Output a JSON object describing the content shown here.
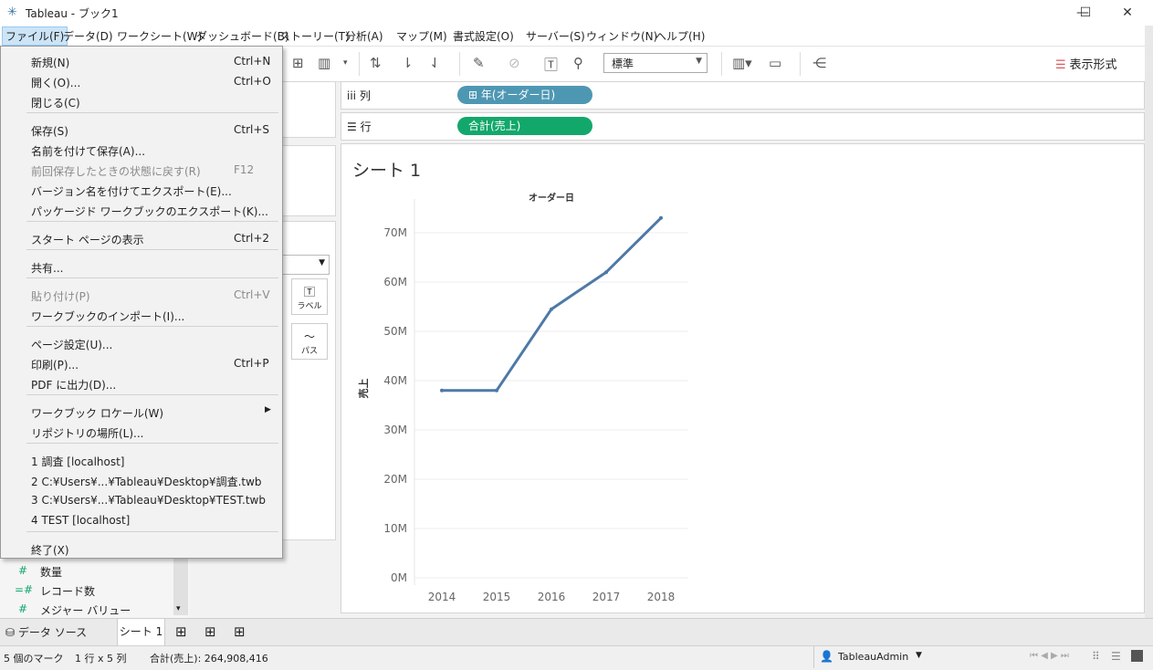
{
  "window": {
    "title": "Tableau - ブック1"
  },
  "menubar": [
    "ファイル(F)",
    "データ(D)",
    "ワークシート(W)",
    "ダッシュボード(B)",
    "ストーリー(T)",
    "分析(A)",
    "マップ(M)",
    "書式設定(O)",
    "サーバー(S)",
    "ウィンドウ(N)",
    "ヘルプ(H)"
  ],
  "toolbar": {
    "zoom_value": "標準",
    "show_me_label": "表示形式"
  },
  "shelves": {
    "columns_label": "列",
    "columns_pill": "⊞ 年(オーダー日)",
    "rows_label": "行",
    "rows_pill": "合計(売上)"
  },
  "colors": {
    "columns_pill": "#4e97b3",
    "rows_pill": "#13a86b",
    "line": "#4e79a7"
  },
  "sheet": {
    "title": "シート 1"
  },
  "marks": {
    "label_button": "ラベル",
    "path_button": "パス"
  },
  "data_pane": {
    "measures": [
      "数量",
      "レコード数",
      "メジャー バリュー"
    ]
  },
  "file_menu": {
    "items": [
      {
        "label": "新規(N)",
        "shortcut": "Ctrl+N"
      },
      {
        "label": "開く(O)...",
        "shortcut": "Ctrl+O"
      },
      {
        "label": "閉じる(C)",
        "shortcut": ""
      },
      {
        "label": "保存(S)",
        "shortcut": "Ctrl+S"
      },
      {
        "label": "名前を付けて保存(A)...",
        "shortcut": ""
      },
      {
        "label": "前回保存したときの状態に戻す(R)",
        "shortcut": "F12"
      },
      {
        "label": "バージョン名を付けてエクスポート(E)...",
        "shortcut": ""
      },
      {
        "label": "パッケージド ワークブックのエクスポート(K)...",
        "shortcut": ""
      },
      {
        "label": "スタート ページの表示",
        "shortcut": "Ctrl+2"
      },
      {
        "label": "共有...",
        "shortcut": ""
      },
      {
        "label": "貼り付け(P)",
        "shortcut": "Ctrl+V"
      },
      {
        "label": "ワークブックのインポート(I)...",
        "shortcut": ""
      },
      {
        "label": "ページ設定(U)...",
        "shortcut": ""
      },
      {
        "label": "印刷(P)...",
        "shortcut": "Ctrl+P"
      },
      {
        "label": "PDF に出力(D)...",
        "shortcut": ""
      },
      {
        "label": "ワークブック ロケール(W)",
        "shortcut": ""
      },
      {
        "label": "リポジトリの場所(L)...",
        "shortcut": ""
      },
      {
        "label": "1 調査 [localhost]",
        "shortcut": ""
      },
      {
        "label": "2 C:¥Users¥...¥Tableau¥Desktop¥調査.twb",
        "shortcut": ""
      },
      {
        "label": "3 C:¥Users¥...¥Tableau¥Desktop¥TEST.twb",
        "shortcut": ""
      },
      {
        "label": "4 TEST [localhost]",
        "shortcut": ""
      },
      {
        "label": "終了(X)",
        "shortcut": ""
      }
    ]
  },
  "tabs": {
    "data_source": "データ ソース",
    "sheet1": "シート 1"
  },
  "status": {
    "marks": "5 個のマーク",
    "dims": "1 行 x 5 列",
    "sum": "合計(売上): 264,908,416",
    "user": "TableauAdmin"
  },
  "chart_data": {
    "type": "line",
    "title": "オーダー日",
    "xlabel": "",
    "ylabel": "売上",
    "categories": [
      "2014",
      "2015",
      "2016",
      "2017",
      "2018"
    ],
    "values": [
      38000000,
      38000000,
      54500000,
      62000000,
      73000000
    ],
    "ylim": [
      0,
      75000000
    ],
    "yticks": [
      "0M",
      "10M",
      "20M",
      "30M",
      "40M",
      "50M",
      "60M",
      "70M"
    ],
    "ytick_values": [
      0,
      10000000,
      20000000,
      30000000,
      40000000,
      50000000,
      60000000,
      70000000
    ],
    "grid": true
  }
}
